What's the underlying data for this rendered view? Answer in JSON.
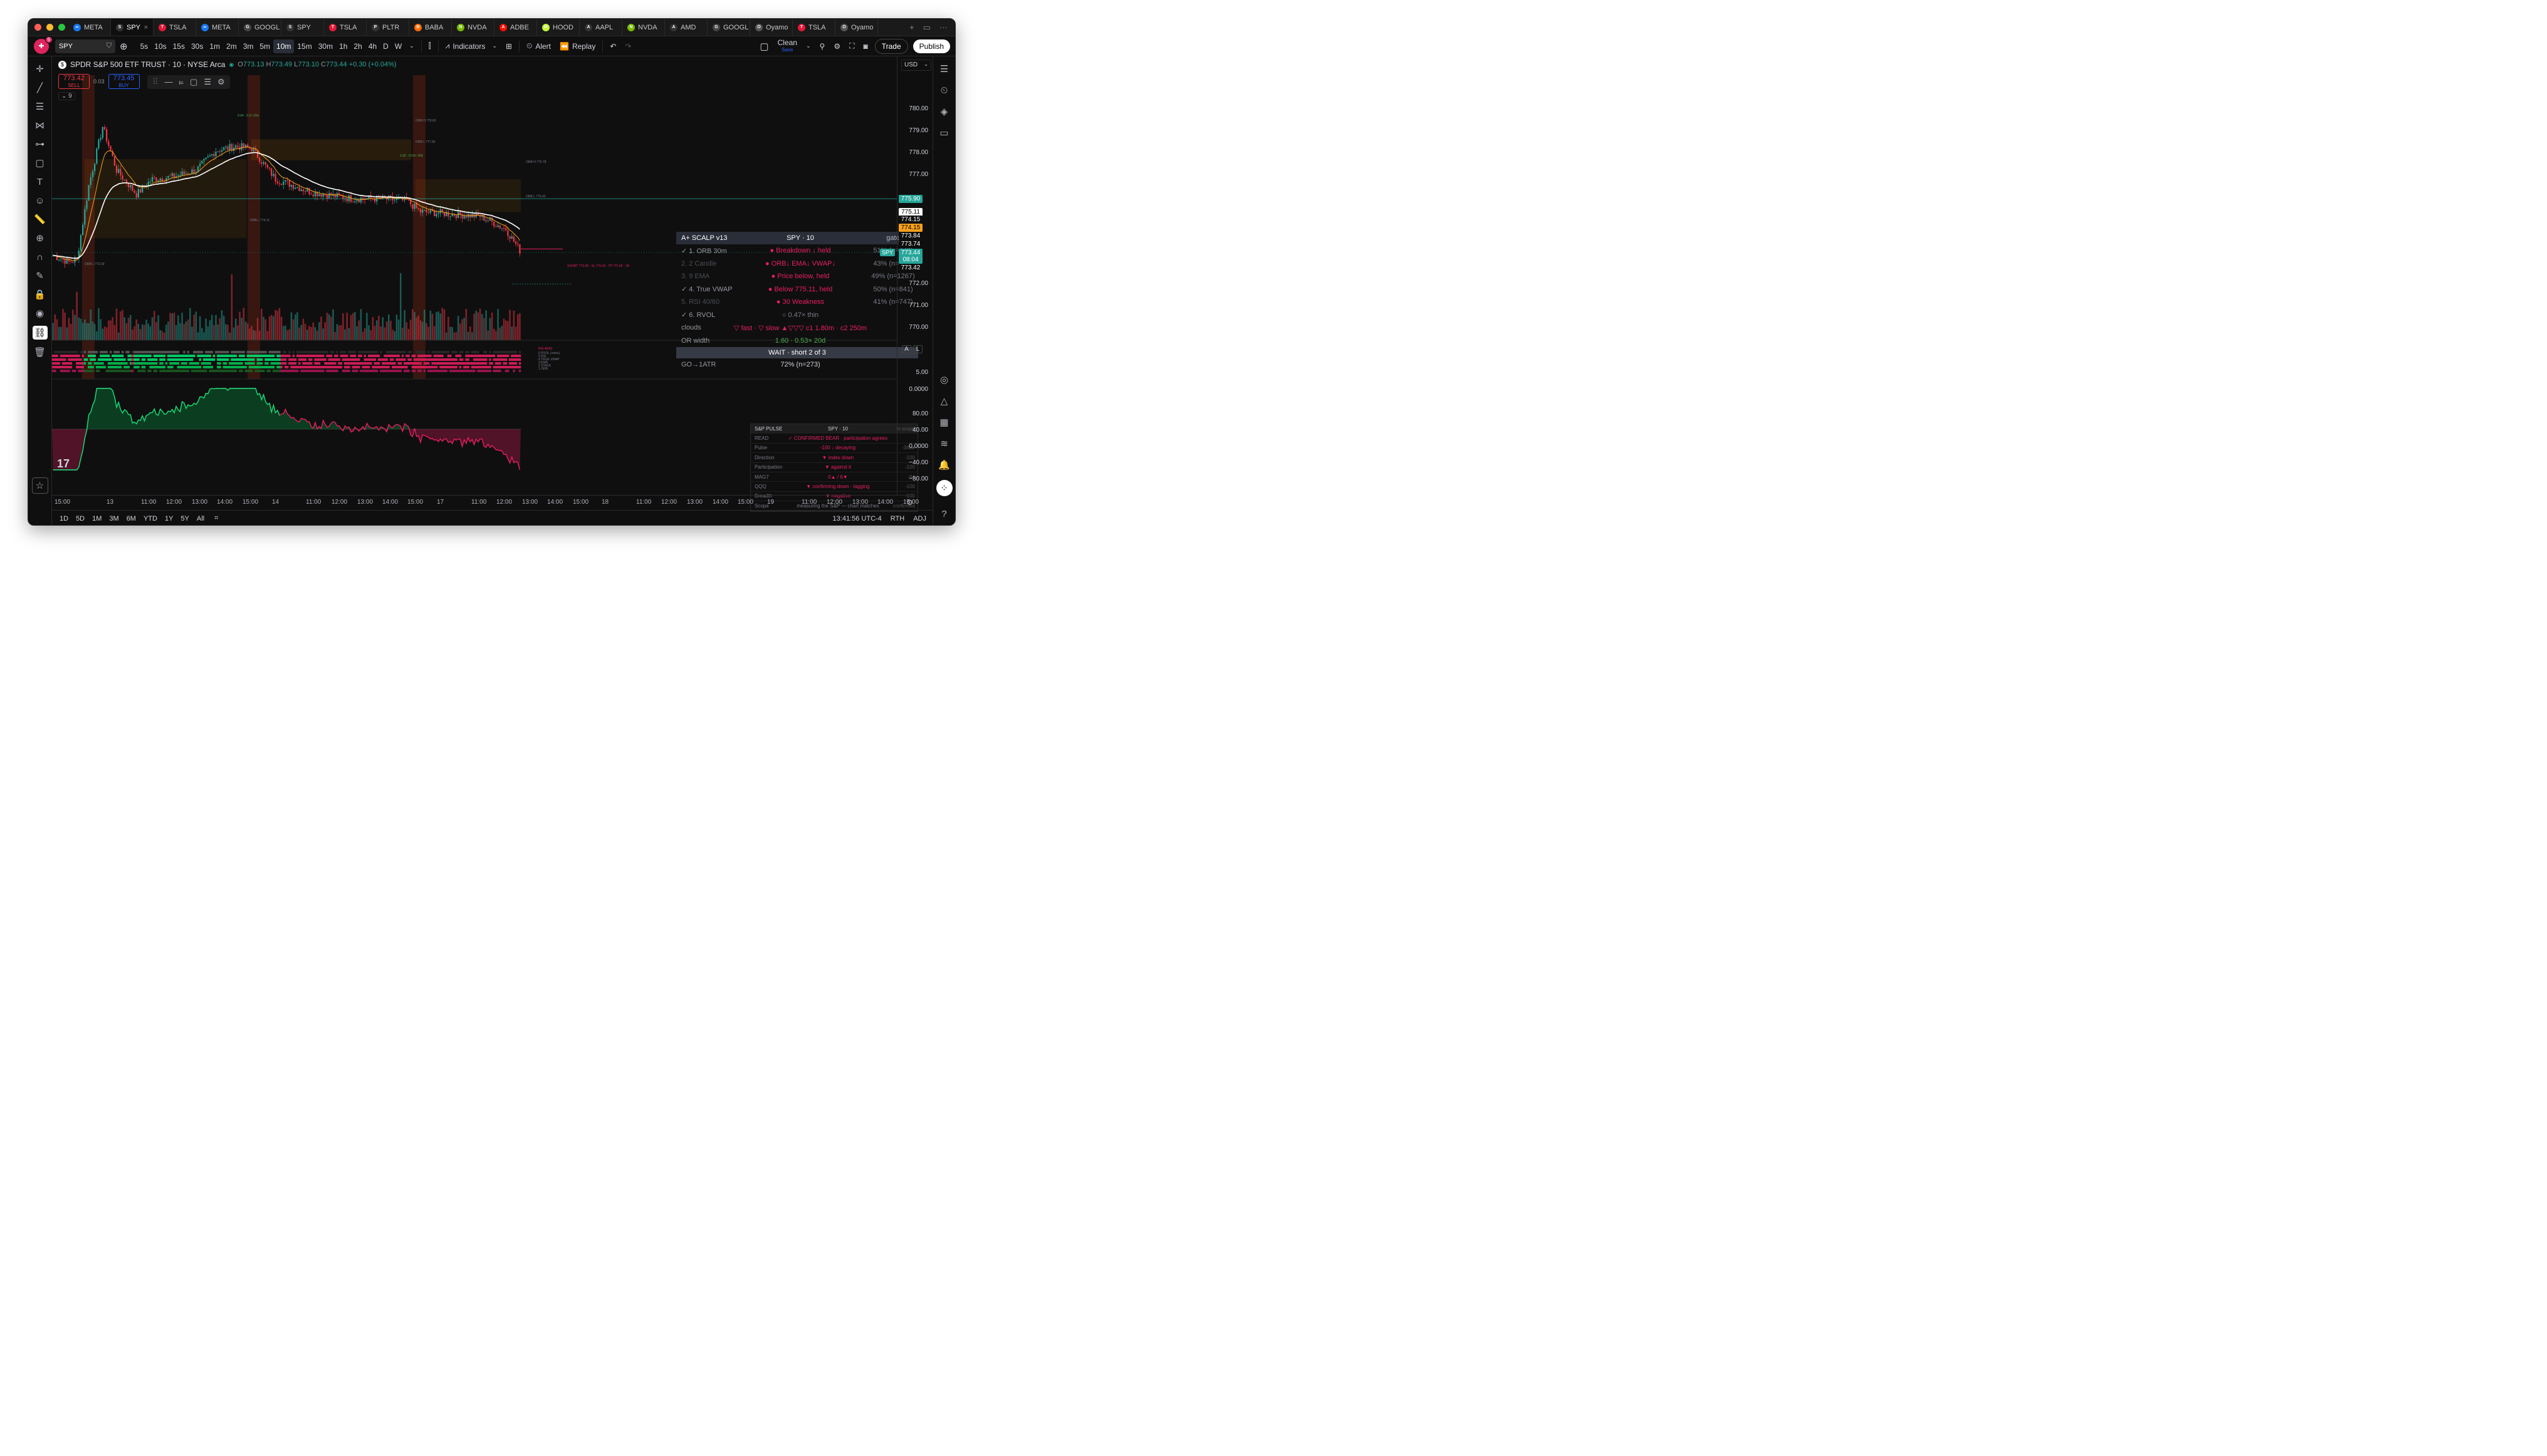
{
  "window_tabs": [
    {
      "label": "META",
      "icon_color": "#1877f2",
      "icon": "∞"
    },
    {
      "label": "SPY",
      "icon_color": "#333",
      "icon": "S",
      "active": true
    },
    {
      "label": "TSLA",
      "icon_color": "#e31937",
      "icon": "T"
    },
    {
      "label": "META",
      "icon_color": "#1877f2",
      "icon": "∞"
    },
    {
      "label": "GOOGL",
      "icon_color": "#444",
      "icon": "G"
    },
    {
      "label": "SPY",
      "icon_color": "#333",
      "icon": "S"
    },
    {
      "label": "TSLA",
      "icon_color": "#e31937",
      "icon": "T"
    },
    {
      "label": "PLTR",
      "icon_color": "#333",
      "icon": "P"
    },
    {
      "label": "BABA",
      "icon_color": "#ff6a00",
      "icon": "B"
    },
    {
      "label": "NVDA",
      "icon_color": "#76b900",
      "icon": "N"
    },
    {
      "label": "ADBE",
      "icon_color": "#fa0f00",
      "icon": "A"
    },
    {
      "label": "HOOD",
      "icon_color": "#c3f53c",
      "icon": "H"
    },
    {
      "label": "AAPL",
      "icon_color": "#333",
      "icon": "A"
    },
    {
      "label": "NVDA",
      "icon_color": "#76b900",
      "icon": "N"
    },
    {
      "label": "AMD",
      "icon_color": "#333",
      "icon": "A"
    },
    {
      "label": "GOOGL",
      "icon_color": "#444",
      "icon": "G"
    },
    {
      "label": "Oyamo",
      "icon_color": "#555",
      "icon": "O"
    },
    {
      "label": "TSLA",
      "icon_color": "#e31937",
      "icon": "T"
    },
    {
      "label": "Oyamo",
      "icon_color": "#555",
      "icon": "O"
    }
  ],
  "toolbar": {
    "notif_count": "9",
    "symbol": "SPY",
    "timeframes": [
      "5s",
      "10s",
      "15s",
      "30s",
      "1m",
      "2m",
      "3m",
      "5m",
      "10m",
      "15m",
      "30m",
      "1h",
      "2h",
      "4h",
      "D",
      "W"
    ],
    "active_timeframe": "10m",
    "indicators_label": "Indicators",
    "alert_label": "Alert",
    "replay_label": "Replay",
    "layout_name": "Clean",
    "layout_sub": "Save",
    "trade_label": "Trade",
    "publish_label": "Publish"
  },
  "legend": {
    "title": "SPDR S&P 500 ETF TRUST · 10 · NYSE Arca",
    "open": "773.13",
    "high": "773.49",
    "low": "773.10",
    "close": "773.44",
    "change": "+0.30 (+0.04%)"
  },
  "buy_sell": {
    "sell_price": "773.42",
    "sell_label": "SELL",
    "spread": "0.03",
    "buy_price": "773.45",
    "buy_label": "BUY"
  },
  "indicator_count": "9",
  "price_axis": {
    "currency": "USD",
    "labels": [
      "780.00",
      "779.00",
      "778.00",
      "777.00",
      "772.00",
      "771.00",
      "770.00",
      "5.00",
      "0.0000",
      "80.00",
      "40.00",
      "0.0000",
      "−40.00",
      "−80.00"
    ],
    "tags": [
      {
        "text": "775.90",
        "bg": "#26a69a",
        "fg": "#fff"
      },
      {
        "text": "775.11",
        "bg": "#ffffff",
        "fg": "#000"
      },
      {
        "text": "774.15",
        "bg": "#0f0f0f",
        "fg": "#fff"
      },
      {
        "text": "774.15",
        "bg": "#f7a21b",
        "fg": "#000"
      },
      {
        "text": "773.84",
        "bg": "#0f0f0f",
        "fg": "#fff"
      },
      {
        "text": "773.74",
        "bg": "#0f0f0f",
        "fg": "#fff"
      },
      {
        "text": "773.44",
        "bg": "#26a69a",
        "fg": "#fff"
      },
      {
        "text": "08:04",
        "bg": "#26a69a",
        "fg": "#fff"
      },
      {
        "text": "773.42",
        "bg": "#0f0f0f",
        "fg": "#fff"
      }
    ],
    "spy_tag": "SPY",
    "buttons": [
      "A",
      "L"
    ]
  },
  "scalp_table": {
    "header": [
      "A+ SCALP v13",
      "SPY · 10",
      "gate"
    ],
    "rows": [
      {
        "label": "✓ 1. ORB 30m",
        "status": "● Breakdown ↓ held",
        "stat": "51% (n=448)",
        "label_color": "#9598a1",
        "status_color": "#e91e63"
      },
      {
        "label": "2. 2 Candle",
        "status": "● ORB↓ EMA↓ VWAP↓",
        "stat": "43% (n=615)",
        "label_color": "#4a4d56",
        "status_color": "#e91e63"
      },
      {
        "label": "3. 9 EMA",
        "status": "● Price below, held",
        "stat": "49% (n=1267)",
        "label_color": "#4a4d56",
        "status_color": "#e91e63"
      },
      {
        "label": "✓ 4. True VWAP",
        "status": "● Below 775.11, held",
        "stat": "50% (n=841)",
        "label_color": "#9598a1",
        "status_color": "#e91e63"
      },
      {
        "label": "5. RSI 40/60",
        "status": "● 30 Weakness",
        "stat": "41% (n=747)",
        "label_color": "#4a4d56",
        "status_color": "#e91e63"
      },
      {
        "label": "✓ 6. RVOL",
        "status": "○ 0.47× thin",
        "stat": "",
        "label_color": "#9598a1",
        "status_color": "#787b86"
      },
      {
        "label": "clouds",
        "status": "▽ fast · ▽ slow ▲▽▽▽ c1 1.80m · c2 250m",
        "stat": "",
        "label_color": "#9598a1",
        "status_color": "#e91e63"
      },
      {
        "label": "OR width",
        "status": "1.60 · 0.53× 20d",
        "stat": "",
        "label_color": "#9598a1",
        "status_color": "#4caf50"
      }
    ],
    "wait_text": "WAIT · short 2 of 3",
    "go_label": "GO→1ATR",
    "go_value": "72% (n=273)"
  },
  "pulse_table": {
    "header": [
      "S&P PULSE",
      "SPY · 10",
      "in scope"
    ],
    "rows": [
      {
        "label": "READ",
        "value": "✓ CONFIRMED BEAR · participation agrees",
        "right": ""
      },
      {
        "label": "Pulse",
        "value": "-100 ↓ decaying",
        "right": "-3/bar"
      },
      {
        "label": "Direction",
        "value": "▼ index down",
        "right": "-100"
      },
      {
        "label": "Participation",
        "value": "▼ against it",
        "right": "-100"
      },
      {
        "label": "MAG7",
        "value": "0▲ / 6▼",
        "right": "-94"
      },
      {
        "label": "QQQ",
        "value": "▼ confirming down · lagging",
        "right": "-100"
      },
      {
        "label": "Breadth",
        "value": "▼ negative",
        "right": "-100"
      },
      {
        "label": "Scope",
        "value": "measuring the S&P — chart matches",
        "right": "confirmed"
      }
    ]
  },
  "chart_annotations": [
    "0.94 · 0.3× 20d",
    "ORB H 778.60",
    "ORB L 777.66",
    "1.60 · 0.53× 20d",
    "ORB H 776.78",
    "ORB L 774.11",
    "ORB L 772.09",
    "ORB L 775.43",
    "SHORT 773.58 · SL 775.18 · TP 771.99 · 1R",
    "RSI 40/60",
    "6 RVOL (votes)",
    "5 RSI",
    "4 TRUE VWAP",
    "3 EMA",
    "2 STACK",
    "1 ORB"
  ],
  "time_axis": [
    "15:00",
    "13",
    "11:00",
    "12:00",
    "13:00",
    "14:00",
    "15:00",
    "14",
    "11:00",
    "12:00",
    "13:00",
    "14:00",
    "15:00",
    "17",
    "11:00",
    "12:00",
    "13:00",
    "14:00",
    "15:00",
    "18",
    "11:00",
    "12:00",
    "13:00",
    "14:00",
    "15:00",
    "19",
    "11:00",
    "12:00",
    "13:00",
    "14:00",
    "15:00"
  ],
  "bottom_bar": {
    "ranges": [
      "1D",
      "5D",
      "1M",
      "3M",
      "6M",
      "YTD",
      "1Y",
      "5Y",
      "All"
    ],
    "clock": "13:41:56 UTC-4",
    "session": "RTH",
    "adj": "ADJ"
  },
  "colors": {
    "up": "#26a69a",
    "down": "#f23645",
    "vwap": "#ffffff",
    "ema": "#f7a21b",
    "pink": "#e91e63",
    "green": "#00e676"
  }
}
